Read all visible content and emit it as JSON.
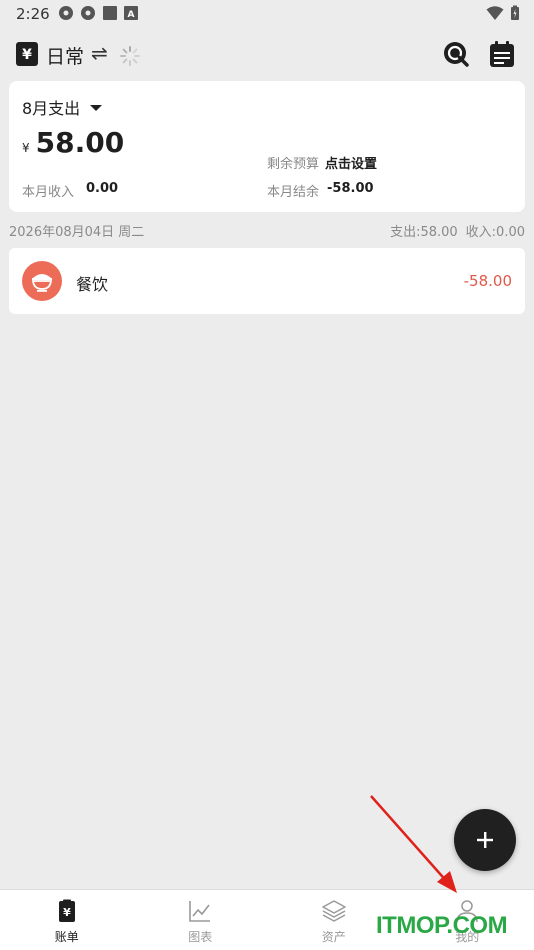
{
  "status_bar": {
    "time": "2:26"
  },
  "header": {
    "book_icon_glyph": "¥",
    "book_title": "日常",
    "swap_glyph": "⇌",
    "search_icon": "search-icon",
    "calendar_icon": "calendar-icon"
  },
  "summary": {
    "month_label": "8月支出",
    "currency": "¥",
    "expense_amount": "58.00",
    "budget_label": "剩余预算",
    "budget_value": "点击设置",
    "income_label": "本月收入",
    "income_value": "0.00",
    "balance_label": "本月结余",
    "balance_value": "-58.00"
  },
  "day": {
    "date": "2026年08月04日 周二",
    "expense_total": "支出:58.00",
    "income_total": "收入:0.00"
  },
  "records": [
    {
      "category": "餐饮",
      "amount": "-58.00",
      "icon": "bowl-icon",
      "icon_color": "#ec6c57"
    }
  ],
  "fab": {
    "icon": "plus-icon"
  },
  "nav": {
    "items": [
      {
        "label": "账单",
        "icon": "bill-icon",
        "active": true
      },
      {
        "label": "图表",
        "icon": "chart-icon",
        "active": false
      },
      {
        "label": "资产",
        "icon": "layers-icon",
        "active": false
      },
      {
        "label": "我的",
        "icon": "user-icon",
        "active": false
      }
    ]
  },
  "watermark": {
    "text": "ITMOP.COM"
  },
  "colors": {
    "accent_red": "#e05a4b",
    "category_red": "#ec6c57",
    "fab": "#202020",
    "watermark_green": "#2aa845"
  }
}
